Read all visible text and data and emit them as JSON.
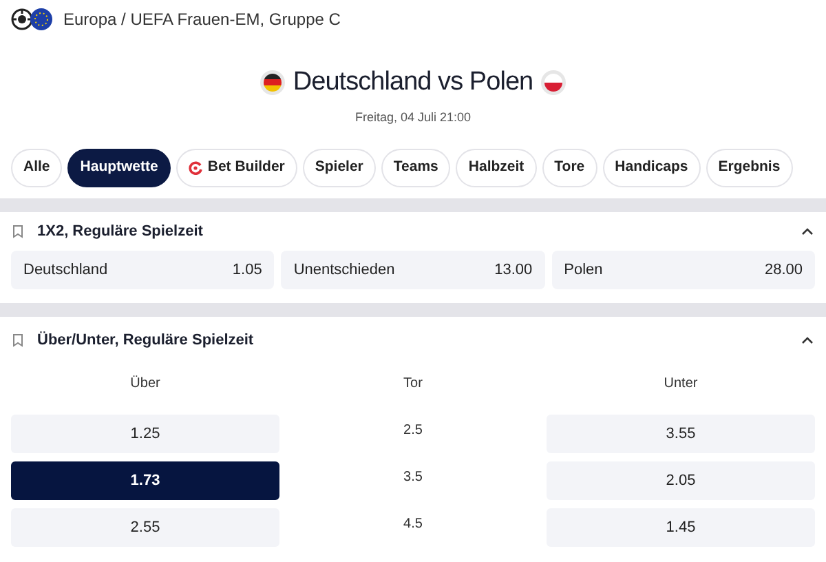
{
  "breadcrumb": "Europa / UEFA Frauen-EM, Gruppe C",
  "match": {
    "home": "Deutschland",
    "separator": "vs",
    "away": "Polen",
    "date": "Freitag, 04 Juli 21:00"
  },
  "tabs": [
    {
      "label": "Alle",
      "selected": false
    },
    {
      "label": "Hauptwette",
      "selected": true
    },
    {
      "label": "Bet Builder",
      "selected": false,
      "kind": "builder"
    },
    {
      "label": "Spieler",
      "selected": false
    },
    {
      "label": "Teams",
      "selected": false
    },
    {
      "label": "Halbzeit",
      "selected": false
    },
    {
      "label": "Tore",
      "selected": false
    },
    {
      "label": "Handicaps",
      "selected": false
    },
    {
      "label": "Ergebnis",
      "selected": false
    }
  ],
  "market_1x2": {
    "title": "1X2, Reguläre Spielzeit",
    "expanded": true,
    "outcomes": [
      {
        "label": "Deutschland",
        "odds": "1.05",
        "selected": false
      },
      {
        "label": "Unentschieden",
        "odds": "13.00",
        "selected": false
      },
      {
        "label": "Polen",
        "odds": "28.00",
        "selected": false
      }
    ]
  },
  "market_over_under": {
    "title": "Über/Unter, Reguläre Spielzeit",
    "expanded": true,
    "columns": [
      "Über",
      "Tor",
      "Unter"
    ],
    "rows": [
      {
        "over": "1.25",
        "over_selected": false,
        "line": "2.5",
        "under": "3.55",
        "under_selected": false
      },
      {
        "over": "1.73",
        "over_selected": true,
        "line": "3.5",
        "under": "2.05",
        "under_selected": false
      },
      {
        "over": "2.55",
        "over_selected": false,
        "line": "4.5",
        "under": "1.45",
        "under_selected": false
      }
    ]
  }
}
